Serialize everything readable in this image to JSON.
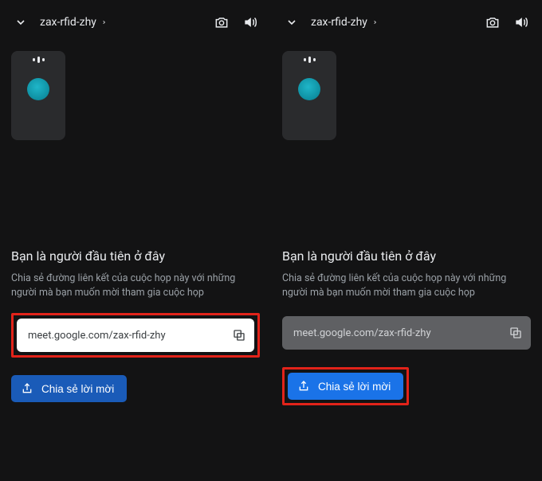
{
  "left": {
    "topbar": {
      "meeting_code": "zax-rfid-zhy"
    },
    "heading": "Bạn là người đầu tiên ở đây",
    "subtext": "Chia sẻ đường liên kết của cuộc họp này với những người mà bạn muốn mời tham gia cuộc họp",
    "link": "meet.google.com/zax-rfid-zhy",
    "share_label": "Chia sẻ lời mời"
  },
  "right": {
    "topbar": {
      "meeting_code": "zax-rfid-zhy"
    },
    "heading": "Bạn là người đầu tiên ở đây",
    "subtext": "Chia sẻ đường liên kết của cuộc họp này với những người mà bạn muốn mời tham gia cuộc họp",
    "link": "meet.google.com/zax-rfid-zhy",
    "share_label": "Chia sẻ lời mời"
  }
}
